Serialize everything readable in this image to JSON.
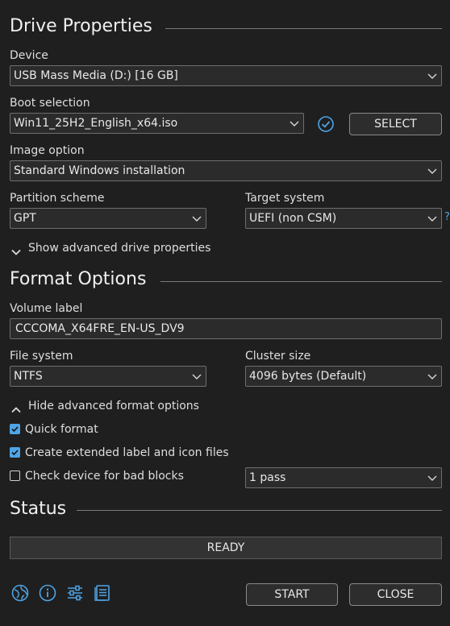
{
  "drive_properties": {
    "title": "Drive Properties",
    "device_label": "Device",
    "device_value": "USB Mass Media (D:) [16 GB]",
    "boot_selection_label": "Boot selection",
    "boot_selection_value": "Win11_25H2_English_x64.iso",
    "select_button": "SELECT",
    "image_option_label": "Image option",
    "image_option_value": "Standard Windows installation",
    "partition_scheme_label": "Partition scheme",
    "partition_scheme_value": "GPT",
    "target_system_label": "Target system",
    "target_system_value": "UEFI (non CSM)",
    "target_help_glyph": "?",
    "advanced_toggle": "Show advanced drive properties"
  },
  "format_options": {
    "title": "Format Options",
    "volume_label_label": "Volume label",
    "volume_label_value": "CCCOMA_X64FRE_EN-US_DV9",
    "file_system_label": "File system",
    "file_system_value": "NTFS",
    "cluster_size_label": "Cluster size",
    "cluster_size_value": "4096 bytes (Default)",
    "advanced_toggle": "Hide advanced format options",
    "quick_format_label": "Quick format",
    "quick_format_checked": true,
    "extended_label_label": "Create extended label and icon files",
    "extended_label_checked": true,
    "bad_blocks_label": "Check device for bad blocks",
    "bad_blocks_checked": false,
    "passes_value": "1 pass"
  },
  "status": {
    "title": "Status",
    "progress_text": "READY"
  },
  "footer": {
    "icons": [
      "globe-icon",
      "info-icon",
      "settings-sliders-icon",
      "log-icon"
    ],
    "start_button": "START",
    "close_button": "CLOSE"
  },
  "colors": {
    "background": "#1f1f1f",
    "accent": "#4ea4e6",
    "field_background": "#2b2b2b",
    "field_border": "#6e6e6e"
  }
}
